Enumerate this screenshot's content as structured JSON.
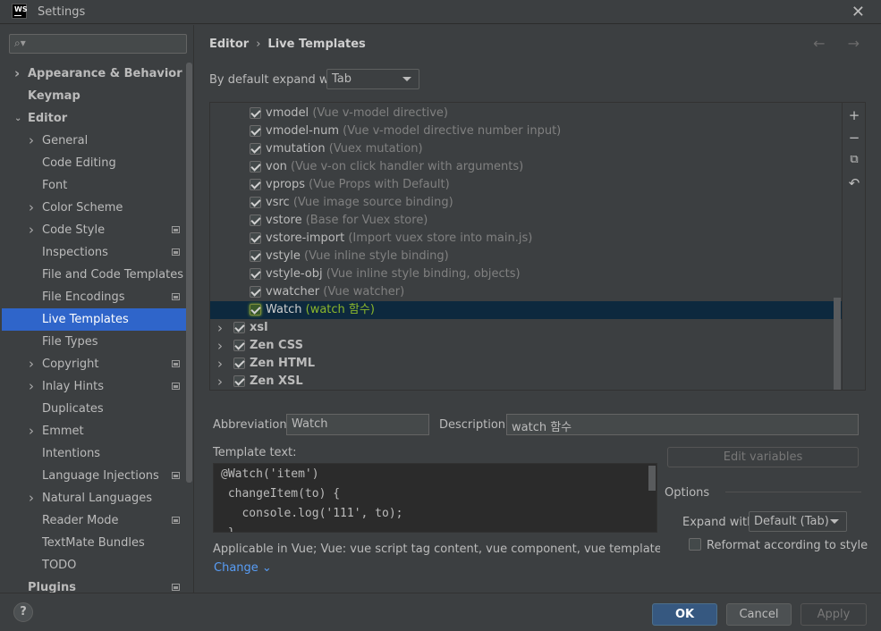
{
  "window": {
    "app_logo": "WS",
    "title": "Settings",
    "close_icon": "close-icon"
  },
  "sidebar": {
    "search_placeholder": "",
    "items": [
      {
        "label": "Appearance & Behavior",
        "bold": true,
        "arrow": "›",
        "level": 0
      },
      {
        "label": "Keymap",
        "bold": true,
        "arrow": "",
        "level": 0
      },
      {
        "label": "Editor",
        "bold": true,
        "arrow": "⌄",
        "level": 0
      },
      {
        "label": "General",
        "arrow": "›",
        "level": 1
      },
      {
        "label": "Code Editing",
        "arrow": "",
        "level": 1
      },
      {
        "label": "Font",
        "arrow": "",
        "level": 1
      },
      {
        "label": "Color Scheme",
        "arrow": "›",
        "level": 1
      },
      {
        "label": "Code Style",
        "arrow": "›",
        "level": 1,
        "proj": true
      },
      {
        "label": "Inspections",
        "arrow": "",
        "level": 1,
        "proj": true
      },
      {
        "label": "File and Code Templates",
        "arrow": "",
        "level": 1
      },
      {
        "label": "File Encodings",
        "arrow": "",
        "level": 1,
        "proj": true
      },
      {
        "label": "Live Templates",
        "arrow": "",
        "level": 1,
        "selected": true
      },
      {
        "label": "File Types",
        "arrow": "",
        "level": 1
      },
      {
        "label": "Copyright",
        "arrow": "›",
        "level": 1,
        "proj": true
      },
      {
        "label": "Inlay Hints",
        "arrow": "›",
        "level": 1,
        "proj": true
      },
      {
        "label": "Duplicates",
        "arrow": "",
        "level": 1
      },
      {
        "label": "Emmet",
        "arrow": "›",
        "level": 1
      },
      {
        "label": "Intentions",
        "arrow": "",
        "level": 1
      },
      {
        "label": "Language Injections",
        "arrow": "",
        "level": 1,
        "proj": true
      },
      {
        "label": "Natural Languages",
        "arrow": "›",
        "level": 1
      },
      {
        "label": "Reader Mode",
        "arrow": "",
        "level": 1,
        "proj": true
      },
      {
        "label": "TextMate Bundles",
        "arrow": "",
        "level": 1
      },
      {
        "label": "TODO",
        "arrow": "",
        "level": 1
      },
      {
        "label": "Plugins",
        "bold": true,
        "arrow": "",
        "level": 0,
        "proj": true
      }
    ]
  },
  "header": {
    "breadcrumb_parent": "Editor",
    "breadcrumb_current": "Live Templates",
    "sep": "›",
    "nav": "← →"
  },
  "expand_with": {
    "label": "By default expand with",
    "value": "Tab"
  },
  "templates": [
    {
      "name": "vmodel",
      "desc": "(Vue v-model directive)"
    },
    {
      "name": "vmodel-num",
      "desc": "(Vue v-model directive number input)"
    },
    {
      "name": "vmutation",
      "desc": "(Vuex mutation)"
    },
    {
      "name": "von",
      "desc": "(Vue v-on click handler with arguments)"
    },
    {
      "name": "vprops",
      "desc": "(Vue Props with Default)"
    },
    {
      "name": "vsrc",
      "desc": "(Vue image source binding)"
    },
    {
      "name": "vstore",
      "desc": "(Base for Vuex store)"
    },
    {
      "name": "vstore-import",
      "desc": "(Import vuex store into main.js)"
    },
    {
      "name": "vstyle",
      "desc": "(Vue inline style binding)"
    },
    {
      "name": "vstyle-obj",
      "desc": "(Vue inline style binding, objects)"
    },
    {
      "name": "vwatcher",
      "desc": "(Vue watcher)"
    },
    {
      "name": "Watch",
      "desc": "(watch 함수)",
      "selected": true
    },
    {
      "name": "xsl",
      "desc": "",
      "group": true
    },
    {
      "name": "Zen CSS",
      "desc": "",
      "group": true
    },
    {
      "name": "Zen HTML",
      "desc": "",
      "group": true
    },
    {
      "name": "Zen XSL",
      "desc": "",
      "group": true
    }
  ],
  "toolbar": {
    "add": "+",
    "remove": "−",
    "copy": "⧉",
    "revert": "↶"
  },
  "details": {
    "abbreviation_label": "Abbreviation:",
    "abbreviation_value": "Watch",
    "description_label": "Description:",
    "description_value": "watch 함수",
    "template_text_label": "Template text:",
    "code_lines": [
      "@Watch('item')",
      " changeItem(to) {",
      "   console.log('111', to);",
      " }"
    ],
    "edit_variables": "Edit variables",
    "options_title": "Options",
    "expand_with_label": "Expand with",
    "expand_with_value": "Default (Tab)",
    "reformat_label": "Reformat according to style",
    "applicable": "Applicable in Vue; Vue: vue script tag content, vue component, vue template, vue templat...",
    "change_link": "Change ⌄"
  },
  "footer": {
    "help": "?",
    "ok": "OK",
    "cancel": "Cancel",
    "apply": "Apply"
  },
  "colors": {
    "selection": "#2f65ca",
    "accent_link": "#589df6",
    "ok_button": "#365880",
    "selected_row": "#0d293e"
  }
}
